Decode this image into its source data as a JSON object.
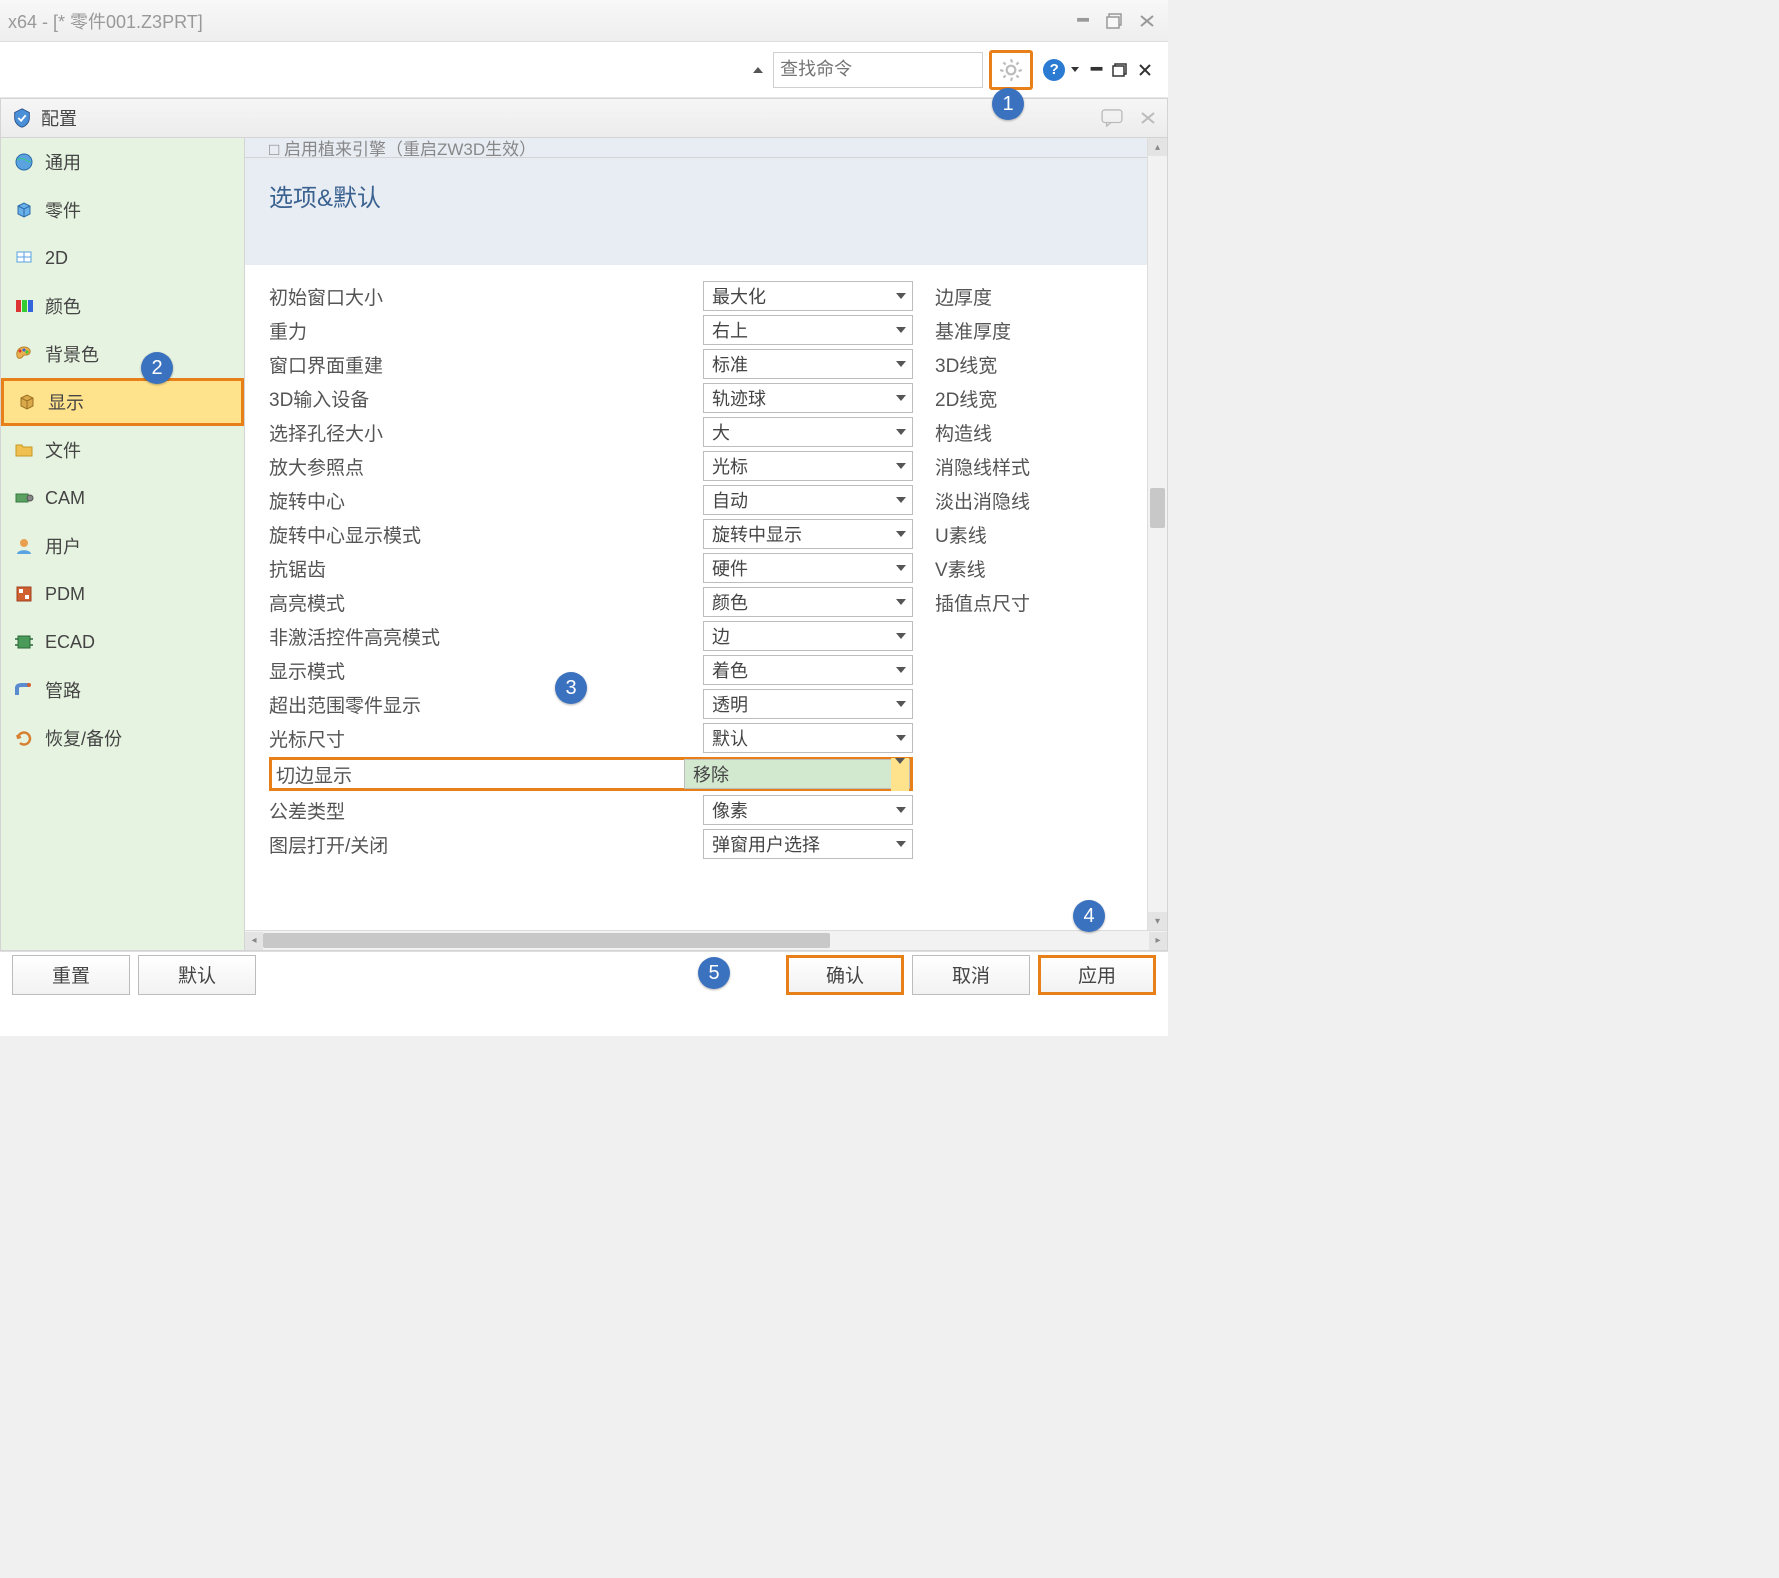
{
  "window": {
    "title": "x64 - [* 零件001.Z3PRT]"
  },
  "search": {
    "placeholder": "查找命令"
  },
  "config": {
    "title": "配置"
  },
  "sidebar": [
    {
      "label": "通用"
    },
    {
      "label": "零件"
    },
    {
      "label": "2D"
    },
    {
      "label": "颜色"
    },
    {
      "label": "背景色"
    },
    {
      "label": "显示"
    },
    {
      "label": "文件"
    },
    {
      "label": "CAM"
    },
    {
      "label": "用户"
    },
    {
      "label": "PDM"
    },
    {
      "label": "ECAD"
    },
    {
      "label": "管路"
    },
    {
      "label": "恢复/备份"
    }
  ],
  "top_cut": "□ 启用植来引擎（重启ZW3D生效）",
  "panel": {
    "title": "选项&默认"
  },
  "rows": [
    {
      "label": "初始窗口大小",
      "value": "最大化",
      "extra": "边厚度"
    },
    {
      "label": "重力",
      "value": "右上",
      "extra": "基准厚度"
    },
    {
      "label": "窗口界面重建",
      "value": "标准",
      "extra": "3D线宽"
    },
    {
      "label": "3D输入设备",
      "value": "轨迹球",
      "extra": "2D线宽"
    },
    {
      "label": "选择孔径大小",
      "value": "大",
      "extra": "构造线"
    },
    {
      "label": "放大参照点",
      "value": "光标",
      "extra": "消隐线样式"
    },
    {
      "label": "旋转中心",
      "value": "自动",
      "extra": "淡出消隐线"
    },
    {
      "label": "旋转中心显示模式",
      "value": "旋转中显示",
      "extra": "U素线"
    },
    {
      "label": "抗锯齿",
      "value": "硬件",
      "extra": "V素线"
    },
    {
      "label": "高亮模式",
      "value": "颜色",
      "extra": "插值点尺寸"
    },
    {
      "label": "非激活控件高亮模式",
      "value": "边",
      "extra": ""
    },
    {
      "label": "显示模式",
      "value": "着色",
      "extra": ""
    },
    {
      "label": "超出范围零件显示",
      "value": "透明",
      "extra": ""
    },
    {
      "label": "光标尺寸",
      "value": "默认",
      "extra": ""
    },
    {
      "label": "切边显示",
      "value": "移除",
      "extra": "",
      "highlight": true
    },
    {
      "label": "公差类型",
      "value": "像素",
      "extra": ""
    },
    {
      "label": "图层打开/关闭",
      "value": "弹窗用户选择",
      "extra": ""
    }
  ],
  "buttons": {
    "reset": "重置",
    "default": "默认",
    "ok": "确认",
    "cancel": "取消",
    "apply": "应用"
  },
  "steps": {
    "s1": "1",
    "s2": "2",
    "s3": "3",
    "s4": "4",
    "s5": "5"
  }
}
